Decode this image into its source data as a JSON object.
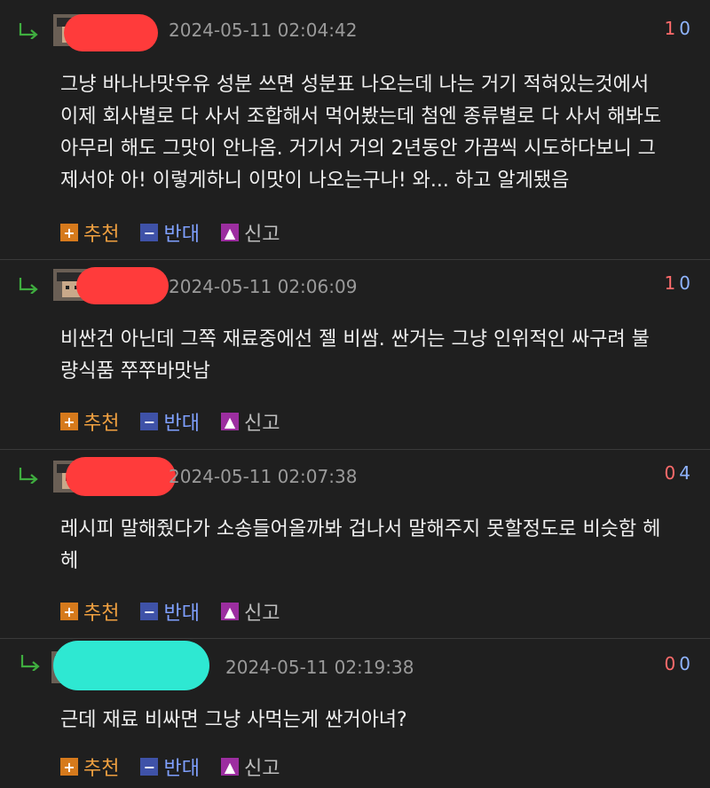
{
  "comments": [
    {
      "date": "2024-05-11 02:04:42",
      "up": "1",
      "down": "0",
      "text": "그냥 바나나맛우유 성분 쓰면 성분표 나오는데 나는 거기 적혀있는것에서\n이제 회사별로 다 사서 조합해서 먹어봤는데 첨엔 종류별로 다 사서 해봐도\n아무리 해도 그맛이 안나옴. 거기서 거의 2년동안 가끔씩 시도하다보니 그\n제서야 아! 이렇게하니 이맛이 나오는구나! 와... 하고 알게됐음"
    },
    {
      "date": "2024-05-11 02:06:09",
      "up": "1",
      "down": "0",
      "text": "비싼건 아닌데 그쪽 재료중에선 젤 비쌈. 싼거는 그냥 인위적인 싸구려 불\n량식품 쭈쭈바맛남"
    },
    {
      "date": "2024-05-11 02:07:38",
      "up": "0",
      "down": "4",
      "text": "레시피 말해줬다가 소송들어올까봐 겁나서 말해주지 못할정도로 비슷함 헤\n헤"
    },
    {
      "date": "2024-05-11 02:19:38",
      "up": "0",
      "down": "0",
      "text": "근데 재료 비싸면 그냥 사먹는게 싼거아녀?"
    }
  ],
  "actions": {
    "recommend": "추천",
    "oppose": "반대",
    "report": "신고",
    "recommend_icon": "plus-icon",
    "oppose_icon": "minus-icon",
    "report_icon": "siren-icon"
  },
  "colors": {
    "background": "#1f1f1f",
    "redact_red": "#ff3b3b",
    "redact_teal": "#2ee8d2",
    "up_vote": "#ff6b6b",
    "down_vote": "#8fb4ff"
  }
}
